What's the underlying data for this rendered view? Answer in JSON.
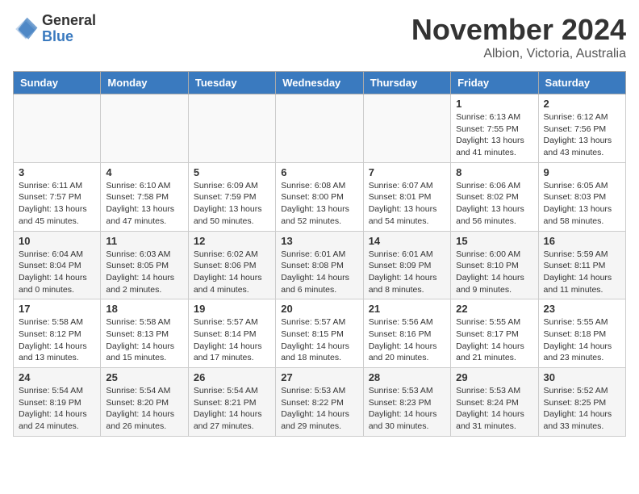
{
  "header": {
    "logo_general": "General",
    "logo_blue": "Blue",
    "month_title": "November 2024",
    "location": "Albion, Victoria, Australia"
  },
  "days_of_week": [
    "Sunday",
    "Monday",
    "Tuesday",
    "Wednesday",
    "Thursday",
    "Friday",
    "Saturday"
  ],
  "weeks": [
    [
      {
        "day": "",
        "empty": true
      },
      {
        "day": "",
        "empty": true
      },
      {
        "day": "",
        "empty": true
      },
      {
        "day": "",
        "empty": true
      },
      {
        "day": "",
        "empty": true
      },
      {
        "day": "1",
        "sunrise": "6:13 AM",
        "sunset": "7:55 PM",
        "daylight": "13 hours and 41 minutes."
      },
      {
        "day": "2",
        "sunrise": "6:12 AM",
        "sunset": "7:56 PM",
        "daylight": "13 hours and 43 minutes."
      }
    ],
    [
      {
        "day": "3",
        "sunrise": "6:11 AM",
        "sunset": "7:57 PM",
        "daylight": "13 hours and 45 minutes."
      },
      {
        "day": "4",
        "sunrise": "6:10 AM",
        "sunset": "7:58 PM",
        "daylight": "13 hours and 47 minutes."
      },
      {
        "day": "5",
        "sunrise": "6:09 AM",
        "sunset": "7:59 PM",
        "daylight": "13 hours and 50 minutes."
      },
      {
        "day": "6",
        "sunrise": "6:08 AM",
        "sunset": "8:00 PM",
        "daylight": "13 hours and 52 minutes."
      },
      {
        "day": "7",
        "sunrise": "6:07 AM",
        "sunset": "8:01 PM",
        "daylight": "13 hours and 54 minutes."
      },
      {
        "day": "8",
        "sunrise": "6:06 AM",
        "sunset": "8:02 PM",
        "daylight": "13 hours and 56 minutes."
      },
      {
        "day": "9",
        "sunrise": "6:05 AM",
        "sunset": "8:03 PM",
        "daylight": "13 hours and 58 minutes."
      }
    ],
    [
      {
        "day": "10",
        "sunrise": "6:04 AM",
        "sunset": "8:04 PM",
        "daylight": "14 hours and 0 minutes."
      },
      {
        "day": "11",
        "sunrise": "6:03 AM",
        "sunset": "8:05 PM",
        "daylight": "14 hours and 2 minutes."
      },
      {
        "day": "12",
        "sunrise": "6:02 AM",
        "sunset": "8:06 PM",
        "daylight": "14 hours and 4 minutes."
      },
      {
        "day": "13",
        "sunrise": "6:01 AM",
        "sunset": "8:08 PM",
        "daylight": "14 hours and 6 minutes."
      },
      {
        "day": "14",
        "sunrise": "6:01 AM",
        "sunset": "8:09 PM",
        "daylight": "14 hours and 8 minutes."
      },
      {
        "day": "15",
        "sunrise": "6:00 AM",
        "sunset": "8:10 PM",
        "daylight": "14 hours and 9 minutes."
      },
      {
        "day": "16",
        "sunrise": "5:59 AM",
        "sunset": "8:11 PM",
        "daylight": "14 hours and 11 minutes."
      }
    ],
    [
      {
        "day": "17",
        "sunrise": "5:58 AM",
        "sunset": "8:12 PM",
        "daylight": "14 hours and 13 minutes."
      },
      {
        "day": "18",
        "sunrise": "5:58 AM",
        "sunset": "8:13 PM",
        "daylight": "14 hours and 15 minutes."
      },
      {
        "day": "19",
        "sunrise": "5:57 AM",
        "sunset": "8:14 PM",
        "daylight": "14 hours and 17 minutes."
      },
      {
        "day": "20",
        "sunrise": "5:57 AM",
        "sunset": "8:15 PM",
        "daylight": "14 hours and 18 minutes."
      },
      {
        "day": "21",
        "sunrise": "5:56 AM",
        "sunset": "8:16 PM",
        "daylight": "14 hours and 20 minutes."
      },
      {
        "day": "22",
        "sunrise": "5:55 AM",
        "sunset": "8:17 PM",
        "daylight": "14 hours and 21 minutes."
      },
      {
        "day": "23",
        "sunrise": "5:55 AM",
        "sunset": "8:18 PM",
        "daylight": "14 hours and 23 minutes."
      }
    ],
    [
      {
        "day": "24",
        "sunrise": "5:54 AM",
        "sunset": "8:19 PM",
        "daylight": "14 hours and 24 minutes."
      },
      {
        "day": "25",
        "sunrise": "5:54 AM",
        "sunset": "8:20 PM",
        "daylight": "14 hours and 26 minutes."
      },
      {
        "day": "26",
        "sunrise": "5:54 AM",
        "sunset": "8:21 PM",
        "daylight": "14 hours and 27 minutes."
      },
      {
        "day": "27",
        "sunrise": "5:53 AM",
        "sunset": "8:22 PM",
        "daylight": "14 hours and 29 minutes."
      },
      {
        "day": "28",
        "sunrise": "5:53 AM",
        "sunset": "8:23 PM",
        "daylight": "14 hours and 30 minutes."
      },
      {
        "day": "29",
        "sunrise": "5:53 AM",
        "sunset": "8:24 PM",
        "daylight": "14 hours and 31 minutes."
      },
      {
        "day": "30",
        "sunrise": "5:52 AM",
        "sunset": "8:25 PM",
        "daylight": "14 hours and 33 minutes."
      }
    ]
  ],
  "labels": {
    "sunrise": "Sunrise:",
    "sunset": "Sunset:",
    "daylight": "Daylight:"
  }
}
